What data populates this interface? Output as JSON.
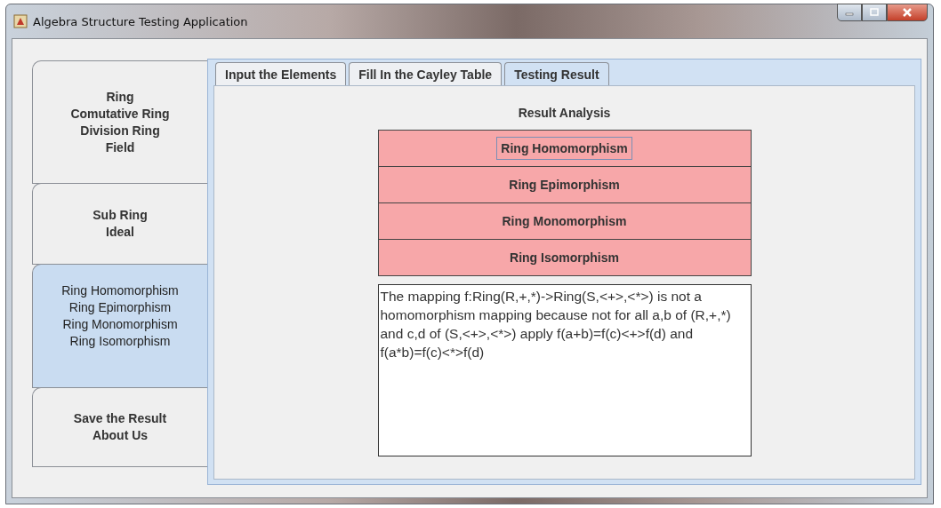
{
  "window": {
    "title": "Algebra Structure Testing Application"
  },
  "side_tabs": [
    {
      "label": "Ring\nComutative Ring\nDivision Ring\nField",
      "selected": false
    },
    {
      "label": "Sub Ring\nIdeal",
      "selected": false
    },
    {
      "label": "Ring Homomorphism\nRing Epimorphism\nRing Monomorphism\nRing Isomorphism",
      "selected": true
    },
    {
      "label": "Save the Result\nAbout Us",
      "selected": false
    }
  ],
  "tabs": [
    {
      "label": "Input the Elements",
      "selected": false
    },
    {
      "label": "Fill In the Cayley Table",
      "selected": false
    },
    {
      "label": "Testing Result",
      "selected": true
    }
  ],
  "result": {
    "heading": "Result Analysis",
    "buttons": [
      {
        "label": "Ring Homomorphism",
        "focused": true
      },
      {
        "label": "Ring Epimorphism",
        "focused": false
      },
      {
        "label": "Ring Monomorphism",
        "focused": false
      },
      {
        "label": "Ring Isomorphism",
        "focused": false
      }
    ],
    "message": "The mapping f:Ring(R,+,*)->Ring(S,<+>,<*>) is not a homomorphism mapping because not for all a,b of (R,+,*) and c,d of (S,<+>,<*>) apply f(a+b)=f(c)<+>f(d) and f(a*b)=f(c)<*>f(d)"
  }
}
